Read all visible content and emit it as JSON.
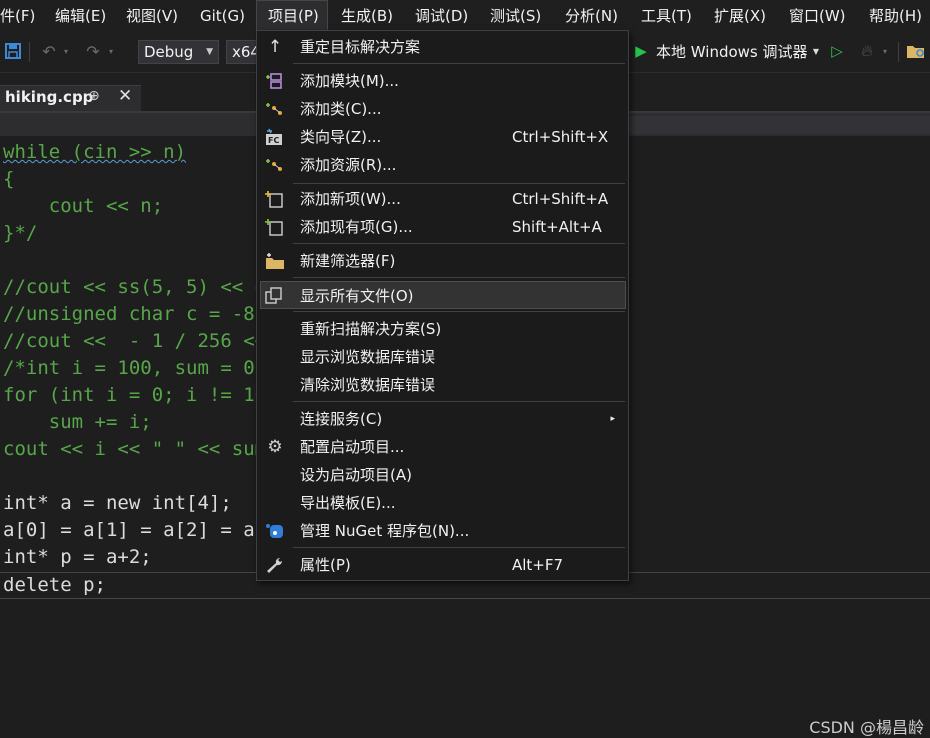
{
  "menubar": {
    "items": [
      "件(F)",
      "编辑(E)",
      "视图(V)",
      "Git(G)",
      "项目(P)",
      "生成(B)",
      "调试(D)",
      "测试(S)",
      "分析(N)",
      "工具(T)",
      "扩展(X)",
      "窗口(W)",
      "帮助(H)"
    ],
    "active": "项目(P)"
  },
  "toolbar": {
    "config": "Debug",
    "platform": "x64",
    "debugger": "本地 Windows 调试器",
    "icons": [
      "save-icon",
      "undo-icon",
      "redo-icon",
      "play-icon",
      "play-outline-icon",
      "hot-reload-icon",
      "folder-icon"
    ]
  },
  "tab": {
    "filename": "hiking.cpp",
    "pin": "⊕",
    "close": "✕"
  },
  "code": {
    "lines": [
      "while (cin >> n)",
      "{",
      "    cout << n;",
      "}*/",
      "",
      "//cout << ss(5, 5) << e",
      "//unsigned char c = -8;",
      "//cout <<  - 1 / 256 <<",
      "/*int i = 100, sum = 0;",
      "for (int i = 0; i != 10",
      "    sum += i;",
      "cout << i << \" \" << sum",
      "",
      "int* a = new int[4];",
      "a[0] = a[1] = a[2] = a[",
      "int* p = a+2;",
      "delete p;"
    ]
  },
  "menu": {
    "items": [
      {
        "icon": "arrow-up-icon",
        "label": "重定目标解决方案",
        "shortcut": ""
      },
      {
        "icon": "add-module-icon",
        "label": "添加模块(M)...",
        "shortcut": ""
      },
      {
        "icon": "add-class-icon",
        "label": "添加类(C)...",
        "shortcut": ""
      },
      {
        "icon": "class-wizard-icon",
        "label": "类向导(Z)...",
        "shortcut": "Ctrl+Shift+X"
      },
      {
        "icon": "add-resource-icon",
        "label": "添加资源(R)...",
        "shortcut": ""
      },
      {
        "icon": "new-item-icon",
        "label": "添加新项(W)...",
        "shortcut": "Ctrl+Shift+A"
      },
      {
        "icon": "existing-item-icon",
        "label": "添加现有项(G)...",
        "shortcut": "Shift+Alt+A"
      },
      {
        "icon": "new-filter-icon",
        "label": "新建筛选器(F)",
        "shortcut": ""
      },
      {
        "icon": "show-all-files-icon",
        "label": "显示所有文件(O)",
        "shortcut": ""
      },
      {
        "icon": "",
        "label": "重新扫描解决方案(S)",
        "shortcut": ""
      },
      {
        "icon": "",
        "label": "显示浏览数据库错误",
        "shortcut": ""
      },
      {
        "icon": "",
        "label": "清除浏览数据库错误",
        "shortcut": ""
      },
      {
        "icon": "",
        "label": "连接服务(C)",
        "shortcut": ""
      },
      {
        "icon": "gear-icon",
        "label": "配置启动项目...",
        "shortcut": ""
      },
      {
        "icon": "",
        "label": "设为启动项目(A)",
        "shortcut": ""
      },
      {
        "icon": "",
        "label": "导出模板(E)...",
        "shortcut": ""
      },
      {
        "icon": "nuget-icon",
        "label": "管理 NuGet 程序包(N)...",
        "shortcut": ""
      },
      {
        "icon": "wrench-icon",
        "label": "属性(P)",
        "shortcut": "Alt+F7"
      }
    ],
    "highlighted": "显示所有文件(O)",
    "submenu_indicator": "▸"
  },
  "watermark": "CSDN @楊昌龄"
}
